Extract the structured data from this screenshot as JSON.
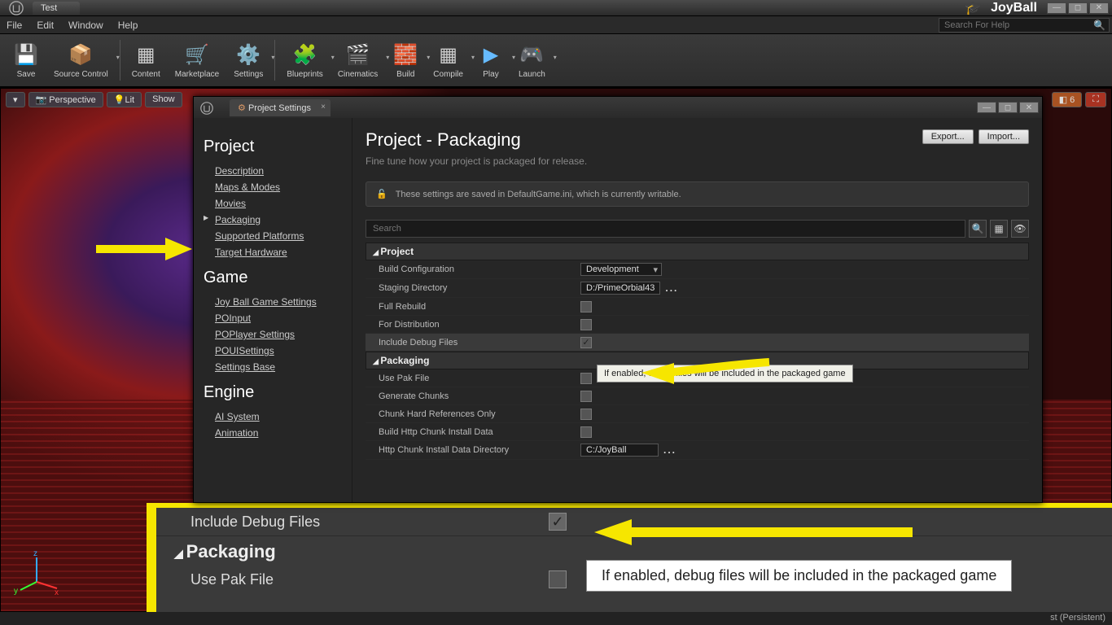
{
  "titlebar": {
    "tab": "Test",
    "project": "JoyBall"
  },
  "menubar": {
    "items": [
      "File",
      "Edit",
      "Window",
      "Help"
    ],
    "search_placeholder": "Search For Help"
  },
  "toolbar": {
    "save": "Save",
    "source_control": "Source Control",
    "content": "Content",
    "marketplace": "Marketplace",
    "settings": "Settings",
    "blueprints": "Blueprints",
    "cinematics": "Cinematics",
    "build": "Build",
    "compile": "Compile",
    "play": "Play",
    "launch": "Launch"
  },
  "viewport": {
    "perspective": "Perspective",
    "lit": "Lit",
    "show": "Show",
    "badge_count": "6"
  },
  "dialog": {
    "tab": "Project Settings",
    "title": "Project - Packaging",
    "subtitle": "Fine tune how your project is packaged for release.",
    "export_btn": "Export...",
    "import_btn": "Import...",
    "info": "These settings are saved in DefaultGame.ini, which is currently writable.",
    "search_placeholder": "Search",
    "tooltip": "If enabled, debug files will be included in the packaged game"
  },
  "sidebar": {
    "project_header": "Project",
    "project_items": [
      "Description",
      "Maps & Modes",
      "Movies",
      "Packaging",
      "Supported Platforms",
      "Target Hardware"
    ],
    "game_header": "Game",
    "game_items": [
      "Joy Ball Game Settings",
      "POInput",
      "POPlayer Settings",
      "POUISettings",
      "Settings Base"
    ],
    "engine_header": "Engine",
    "engine_items": [
      "AI System",
      "Animation"
    ]
  },
  "props": {
    "project_section": "Project",
    "build_config": {
      "label": "Build Configuration",
      "value": "Development"
    },
    "staging_dir": {
      "label": "Staging Directory",
      "value": "D:/PrimeOrbial43"
    },
    "full_rebuild": {
      "label": "Full Rebuild"
    },
    "for_dist": {
      "label": "For Distribution"
    },
    "include_debug": {
      "label": "Include Debug Files",
      "checked": true
    },
    "packaging_section": "Packaging",
    "use_pak": {
      "label": "Use Pak File"
    },
    "gen_chunks": {
      "label": "Generate Chunks"
    },
    "chunk_hard": {
      "label": "Chunk Hard References Only"
    },
    "build_http": {
      "label": "Build Http Chunk Install Data"
    },
    "http_dir": {
      "label": "Http Chunk Install Data Directory",
      "value": "C:/JoyBall"
    }
  },
  "zoom": {
    "include_debug": "Include Debug Files",
    "packaging": "Packaging",
    "use_pak": "Use Pak File",
    "tooltip": "If enabled, debug files will be included in the packaged game"
  },
  "status": {
    "text": "st (Persistent)"
  }
}
